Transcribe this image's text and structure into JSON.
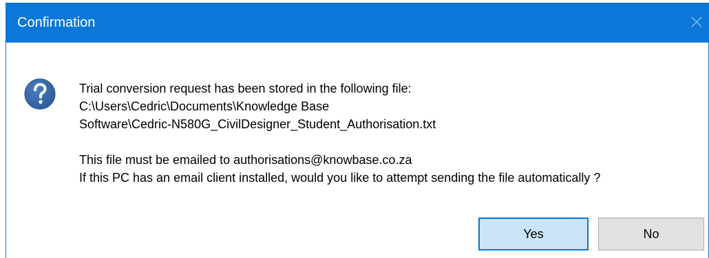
{
  "window": {
    "title": "Confirmation",
    "title_bar_color": "#0b78d7"
  },
  "icons": {
    "dialog_icon": "question-icon",
    "close": "close-icon"
  },
  "message": {
    "lines": [
      "Trial conversion request has been stored in the following file:",
      "C:\\Users\\Cedric\\Documents\\Knowledge Base",
      "Software\\Cedric-N580G_CivilDesigner_Student_Authorisation.txt",
      "This file must be emailed to authorisations@knowbase.co.za",
      "If this PC has an email client installed, would you like to attempt sending the file automatically ?"
    ]
  },
  "buttons": {
    "yes_label": "Yes",
    "no_label": "No"
  }
}
